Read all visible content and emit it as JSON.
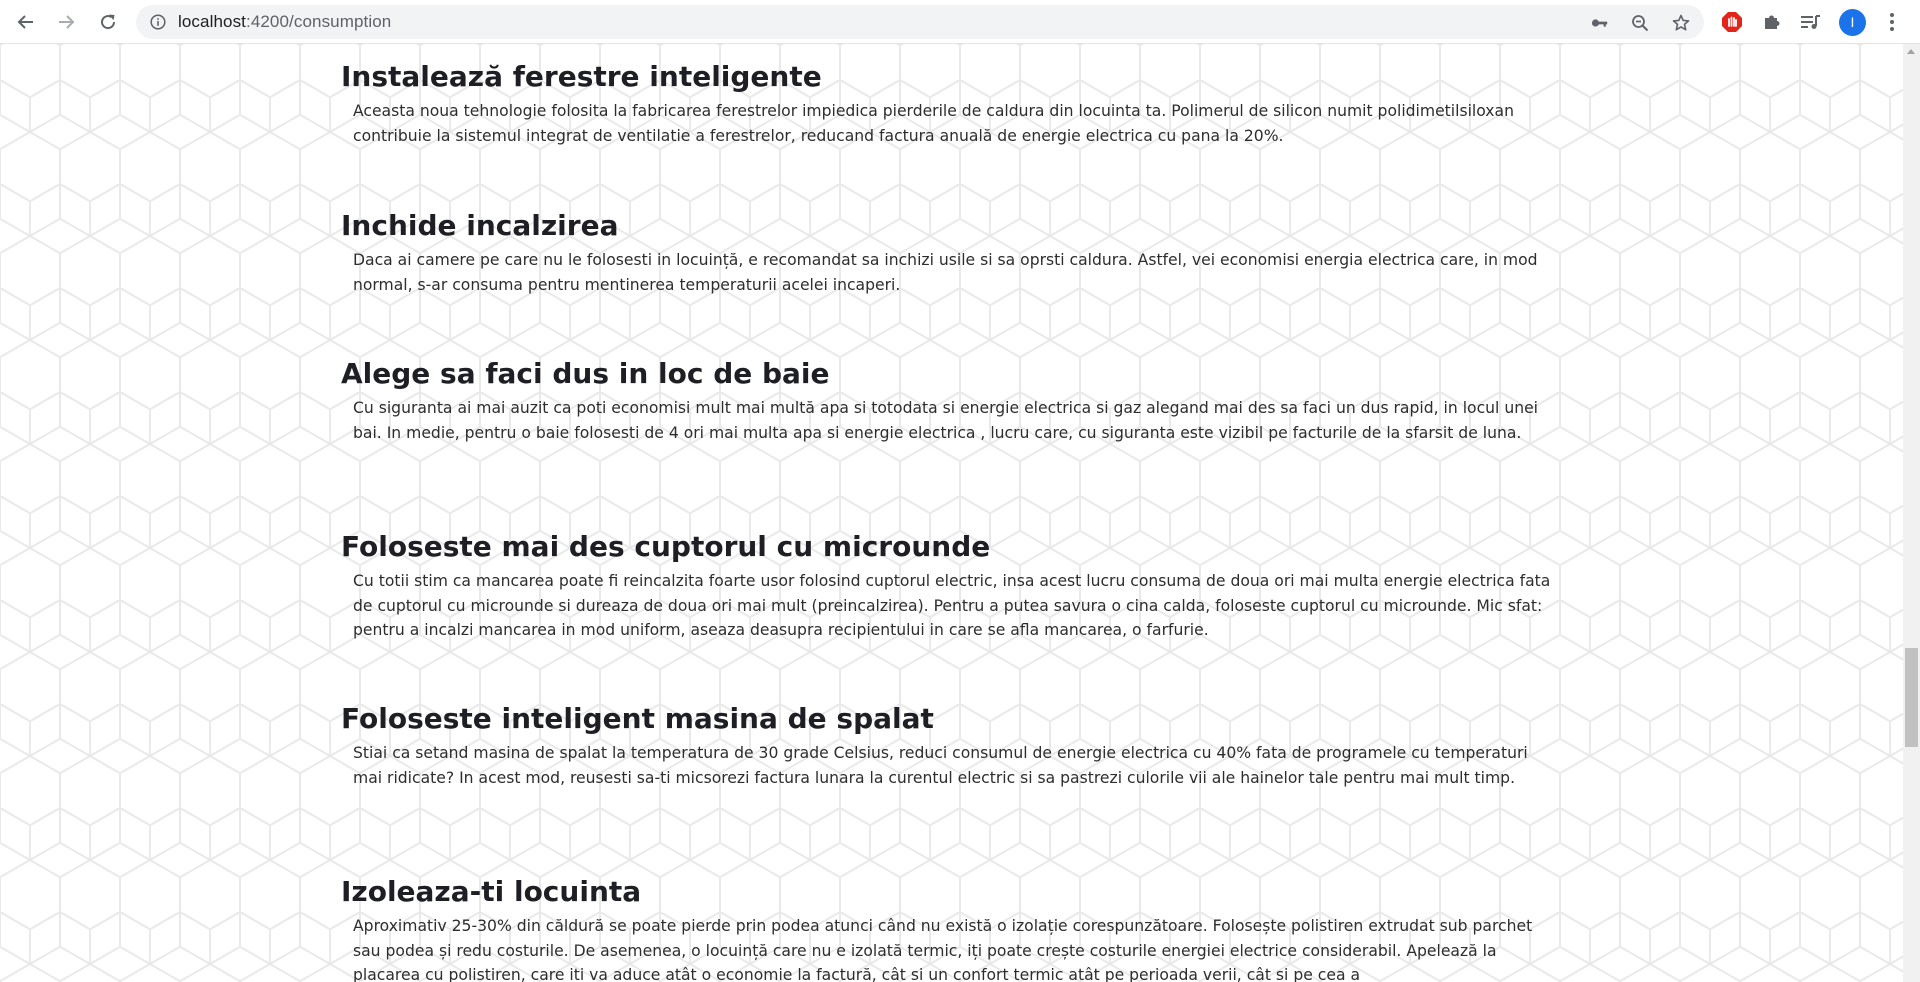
{
  "browser": {
    "url_host": "localhost",
    "url_path": ":4200/consumption",
    "avatar_letter": "I",
    "icons": {
      "back": "arrow-back-icon",
      "forward": "arrow-forward-icon",
      "reload": "reload-icon",
      "site_info": "info-icon",
      "passwords": "key-icon",
      "zoom": "zoom-icon",
      "bookmark": "star-icon",
      "adblock": "stop-hand-icon",
      "extensions": "puzzle-icon",
      "reading_list": "reading-list-icon",
      "menu": "kebab-menu-icon"
    }
  },
  "tips": [
    {
      "title": "Instalează ferestre inteligente",
      "text": "Aceasta noua tehnologie folosita la fabricarea ferestrelor impiedica pierderile de caldura din locuinta ta. Polimerul de silicon numit polidimetilsiloxan contribuie la sistemul integrat de ventilatie a ferestrelor, reducand factura anuală de energie electrica cu pana la 20%."
    },
    {
      "title": "Inchide incalzirea",
      "text": "Daca ai camere pe care nu le folosesti in locuință, e recomandat sa inchizi usile si sa oprsti caldura. Astfel, vei economisi energia electrica care, in mod normal, s-ar consuma pentru mentinerea temperaturii acelei incaperi."
    },
    {
      "title": "Alege sa faci dus in loc de baie",
      "text": "Cu siguranta ai mai auzit ca poti economisi mult mai multă apa si totodata si energie electrica si gaz alegand mai des sa faci un dus rapid, in locul unei bai. In medie, pentru o baie folosesti de 4 ori mai multa apa si energie electrica , lucru care, cu siguranta este vizibil pe facturile de la sfarsit de luna."
    },
    {
      "title": "Foloseste mai des cuptorul cu microunde",
      "text": "Cu totii stim ca mancarea poate fi reincalzita foarte usor folosind cuptorul electric, insa acest lucru consuma de doua ori mai multa energie electrica fata de cuptorul cu microunde si dureaza de doua ori mai mult (preincalzirea). Pentru a putea savura o cina calda, foloseste cuptorul cu microunde. Mic sfat: pentru a incalzi mancarea in mod uniform, aseaza deasupra recipientului in care se afla mancarea, o farfurie."
    },
    {
      "title": "Foloseste inteligent masina de spalat",
      "text": "Stiai ca setand masina de spalat la temperatura de 30 grade Celsius, reduci consumul de energie electrica cu 40% fata de programele cu temperaturi mai ridicate? In acest mod, reusesti sa-ti micsorezi factura lunara la curentul electric si sa pastrezi culorile vii ale hainelor tale pentru mai mult timp."
    },
    {
      "title": "Izoleaza-ti locuinta",
      "text": "Aproximativ 25-30% din căldură se poate pierde prin podea atunci când nu există o izolație corespunzătoare. Folosește polistiren extrudat sub parchet sau podea și redu costurile. De asemenea, o locuință care nu e izolată termic, iți poate crește costurile energiei electrice considerabil. Apelează la placarea cu polistiren, care iti va aduce atât o economie la factură, cât si un confort termic atât pe perioada verii, cât si pe cea a"
    }
  ]
}
